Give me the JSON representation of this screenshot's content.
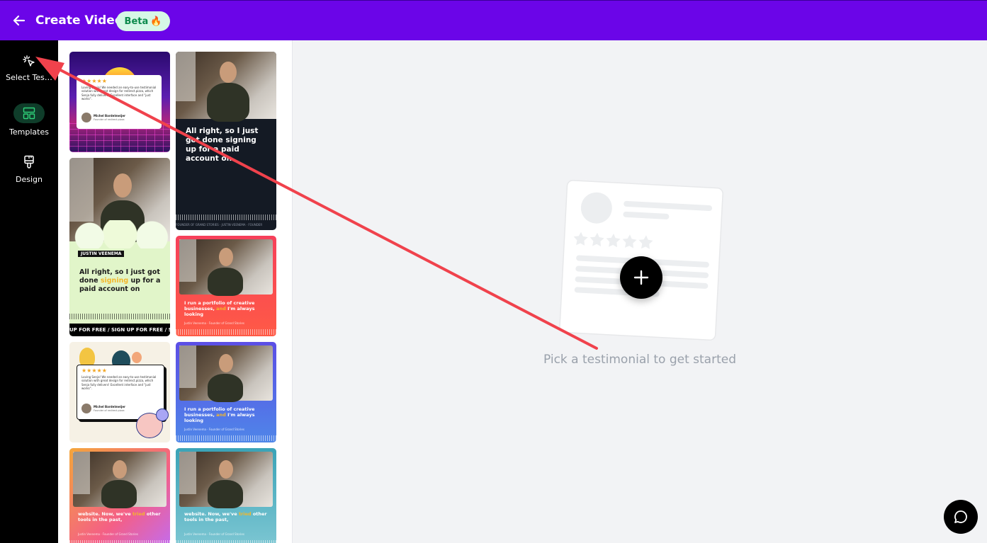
{
  "header": {
    "back_icon": "arrow-left-icon",
    "title": "Create Video",
    "badge": "Beta",
    "badge_emoji": "🔥",
    "colors": {
      "bar": "#6b05e8",
      "badge_bg": "#d6f7e6",
      "badge_text": "#0c8a4d"
    }
  },
  "sidebar": {
    "items": [
      {
        "label": "Select Tes…",
        "icon": "cursor-click-icon",
        "active": false
      },
      {
        "label": "Templates",
        "icon": "layout-icon",
        "active": true
      },
      {
        "label": "Design",
        "icon": "paintbrush-icon",
        "active": false
      }
    ]
  },
  "templates": {
    "cards": [
      {
        "style": "retro-synthwave",
        "rating": "★★★★★",
        "review": "Loving Senja! We needed an easy-to-use testimonial solution with great design for redirect.pizza, which Senja fully delivers! Excellent interface and \"just works\".",
        "author": "Michel Bardelmeijer",
        "role": "Founder of redirect.pizza"
      },
      {
        "style": "dark-video",
        "quote": "All right, so I just got done signing up for a paid account on",
        "ticker": "FOUNDER OF GRAND STORIES · JUSTIN VEENEMA · FOUNDER"
      },
      {
        "style": "green-cloud",
        "name_tag": "JUSTIN VEENEMA",
        "quote_pre": "All right, so I just got done ",
        "quote_hl": "signing",
        "quote_post": " up for a paid account on",
        "ticker": "UP FOR FREE / SIGN UP FOR FREE / SIG"
      },
      {
        "style": "red-gradient",
        "quote_pre": "I run a portfolio of creative businesses, ",
        "quote_hl": "and",
        "quote_post": " I'm always looking",
        "author": "Justin Veenema · Founder of Grand Stories"
      },
      {
        "style": "floral",
        "rating": "★★★★★",
        "review": "Loving Senja! We needed an easy-to-use testimonial solution with great design for redirect.pizza, which Senja fully delivers! Excellent interface and \"just works\".",
        "author": "Michel Bardelmeijer",
        "role": "Founder of redirect.pizza"
      },
      {
        "style": "blue-gradient",
        "quote_pre": "I run a portfolio of creative businesses, ",
        "quote_hl": "and",
        "quote_post": " I'm always looking",
        "author": "Justin Veenema · Founder of Grand Stories"
      },
      {
        "style": "sunset-gradient",
        "quote_pre": "website. Now, we've ",
        "quote_hl": "tried",
        "quote_post": " other tools in the past,",
        "author": "Justin Veenema · Founder of Grand Stories"
      },
      {
        "style": "teal-gradient",
        "quote_pre": "website. Now, we've ",
        "quote_hl": "tried",
        "quote_post": " other tools in the past,",
        "author": "Justin Veenema · Founder of Grand Stories"
      }
    ]
  },
  "main": {
    "empty_state_text": "Pick a testimonial to get started",
    "add_icon": "plus-icon"
  },
  "chat": {
    "icon": "chat-bubble-icon"
  },
  "annotation": {
    "color": "#f0424c",
    "shape": "arrow",
    "points_to": "Select Tes…"
  }
}
